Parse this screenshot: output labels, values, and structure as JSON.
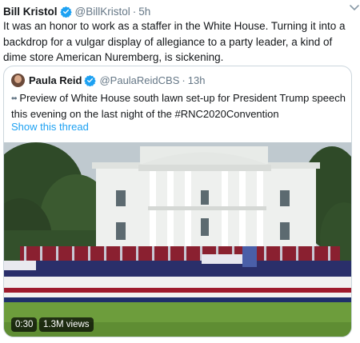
{
  "tweet": {
    "author_name": "Bill Kristol",
    "author_handle": "@BillKristol",
    "separator": "·",
    "time": "5h",
    "text": "It was an honor to work as a staffer in the White House. Turning it into a backdrop for a vulgar display of allegiance to a party leader, a kind of dime store American Nuremberg, is sickening."
  },
  "quoted_tweet": {
    "author_name": "Paula Reid",
    "author_handle": "@PaulaReidCBS",
    "separator": "·",
    "time": "13h",
    "thread_glyph": "••",
    "text": "Preview of White House south lawn set-up for President Trump speech this evening on the last night of the #RNC2020Convention",
    "show_thread_label": "Show this thread"
  },
  "video": {
    "duration": "0:30",
    "views": "1.3M views"
  },
  "colors": {
    "link": "#1da1f2",
    "verified": "#1da1f2",
    "muted": "#657786",
    "border": "#ccd6dd"
  },
  "icons": {
    "verified": "verified-badge-icon",
    "menu": "chevron-down-icon"
  }
}
